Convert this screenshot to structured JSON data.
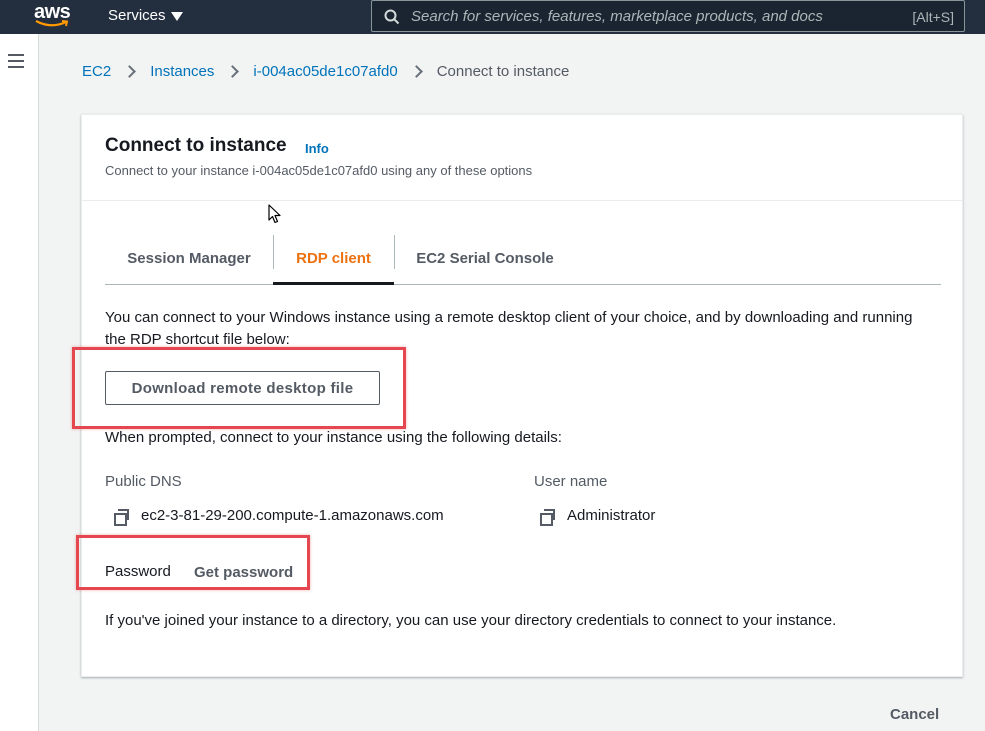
{
  "topnav": {
    "logo_text": "aws",
    "services_label": "Services",
    "search_placeholder": "Search for services, features, marketplace products, and docs",
    "search_shortcut": "[Alt+S]"
  },
  "breadcrumb": {
    "items": [
      "EC2",
      "Instances",
      "i-004ac05de1c07afd0"
    ],
    "current": "Connect to instance"
  },
  "panel": {
    "title": "Connect to instance",
    "info_label": "Info",
    "description": "Connect to your instance i-004ac05de1c07afd0 using any of these options"
  },
  "tabs": [
    {
      "label": "Session Manager",
      "active": false
    },
    {
      "label": "RDP client",
      "active": true
    },
    {
      "label": "EC2 Serial Console",
      "active": false
    }
  ],
  "rdp": {
    "intro": "You can connect to your Windows instance using a remote desktop client of your choice, and by downloading and running the RDP shortcut file below:",
    "download_label": "Download remote desktop file",
    "prompt": "When prompted, connect to your instance using the following details:",
    "public_dns_label": "Public DNS",
    "public_dns_value": "ec2-3-81-29-200.compute-1.amazonaws.com",
    "username_label": "User name",
    "username_value": "Administrator",
    "password_label": "Password",
    "get_password_label": "Get password",
    "footer": "If you've joined your instance to a directory, you can use your directory credentials to connect to your instance."
  },
  "actions": {
    "cancel_label": "Cancel"
  },
  "colors": {
    "nav_bg": "#232f3e",
    "link": "#0073bb",
    "active_tab": "#ec7211",
    "highlight_box": "#e4474f"
  }
}
